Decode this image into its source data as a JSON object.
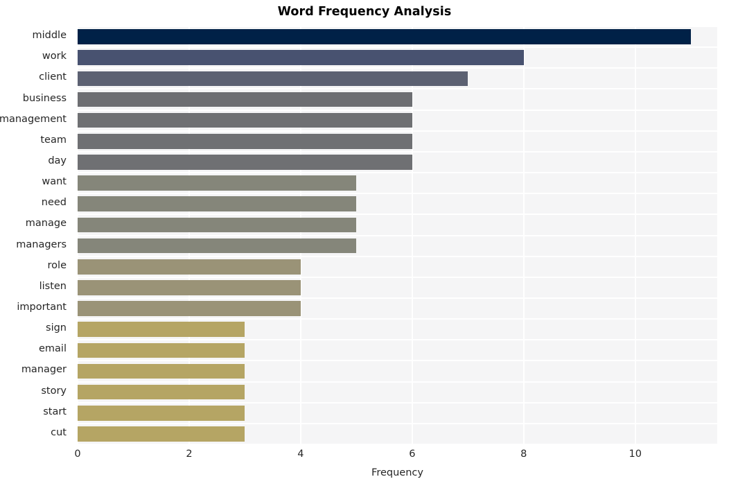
{
  "chart_data": {
    "type": "bar",
    "orientation": "horizontal",
    "title": "Word Frequency Analysis",
    "xlabel": "Frequency",
    "ylabel": "",
    "xlim": [
      0,
      11.47
    ],
    "ylim": [
      0,
      20
    ],
    "grid": true,
    "legend": null,
    "xticks": [
      "0",
      "2",
      "4",
      "6",
      "8",
      "10"
    ],
    "xtick_values": [
      0,
      2,
      4,
      6,
      8,
      10
    ],
    "categories": [
      "middle",
      "work",
      "client",
      "business",
      "management",
      "team",
      "day",
      "want",
      "need",
      "manage",
      "managers",
      "role",
      "listen",
      "important",
      "sign",
      "email",
      "manager",
      "story",
      "start",
      "cut"
    ],
    "values": [
      11,
      8,
      7,
      6,
      6,
      6,
      6,
      5,
      5,
      5,
      5,
      4,
      4,
      4,
      3,
      3,
      3,
      3,
      3,
      3
    ],
    "bar_colors": [
      "#002147",
      "#485270",
      "#5c6172",
      "#6d6e72",
      "#6f7073",
      "#6f7073",
      "#6f7073",
      "#85867a",
      "#85867a",
      "#85867a",
      "#85867a",
      "#9a9377",
      "#9a9377",
      "#9a9377",
      "#b5a564",
      "#b5a564",
      "#b5a564",
      "#b5a564",
      "#b5a564",
      "#b5a564"
    ],
    "plot_background": "#f5f5f6",
    "gridline_color": "#ffffff",
    "figure_background": "#ffffff",
    "text_color": "#262626"
  }
}
